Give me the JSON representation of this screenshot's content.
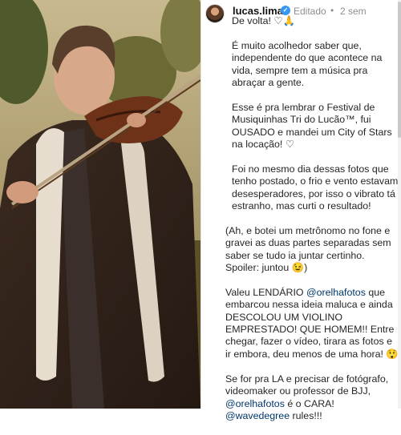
{
  "post": {
    "username": "lucas.lima",
    "edited_label": "Editado",
    "separator": "•",
    "time_ago": "2 sem"
  },
  "caption": {
    "p1": "De volta! ♡🙏",
    "p2": "É muito acolhedor saber que, independente do que acontece na vida, sempre tem a música pra abraçar a gente.",
    "p3": "Esse é pra lembrar o Festival de Musiquinhas Tri do Lucão™, fui OUSADO e mandei um City of Stars na locação! ♡",
    "p4": "Foi no mesmo dia dessas fotos que tenho postado, o frio e vento estavam desesperadores, por isso o vibrato tá estranho, mas curti o resultado!",
    "p5": "(Ah, e botei um metrônomo no fone e gravei as duas partes separadas sem saber se tudo ia juntar certinho. Spoiler: juntou 😉)",
    "p6_a": "Valeu LENDÁRIO ",
    "p6_mention": "@orelhafotos",
    "p6_b": " que embarcou nessa ideia maluca e ainda DESCOLOU UM VIOLINO EMPRESTADO! QUE HOMEM!! Entre chegar, fazer o vídeo, tirara as fotos e ir embora, deu menos de uma hora! 😲",
    "p7_a": "Se for pra LA e precisar de fotógrafo, videomaker ou professor de BJJ, ",
    "p7_mention1": "@orelhafotos",
    "p7_b": " é o CARA! ",
    "p7_mention2": "@wavedegree",
    "p7_c": " rules!!!"
  },
  "colors": {
    "mention": "#00376b",
    "verified": "#3897f0",
    "muted": "#8e8e8e"
  },
  "icons": {
    "verified": "verified-badge-icon"
  }
}
